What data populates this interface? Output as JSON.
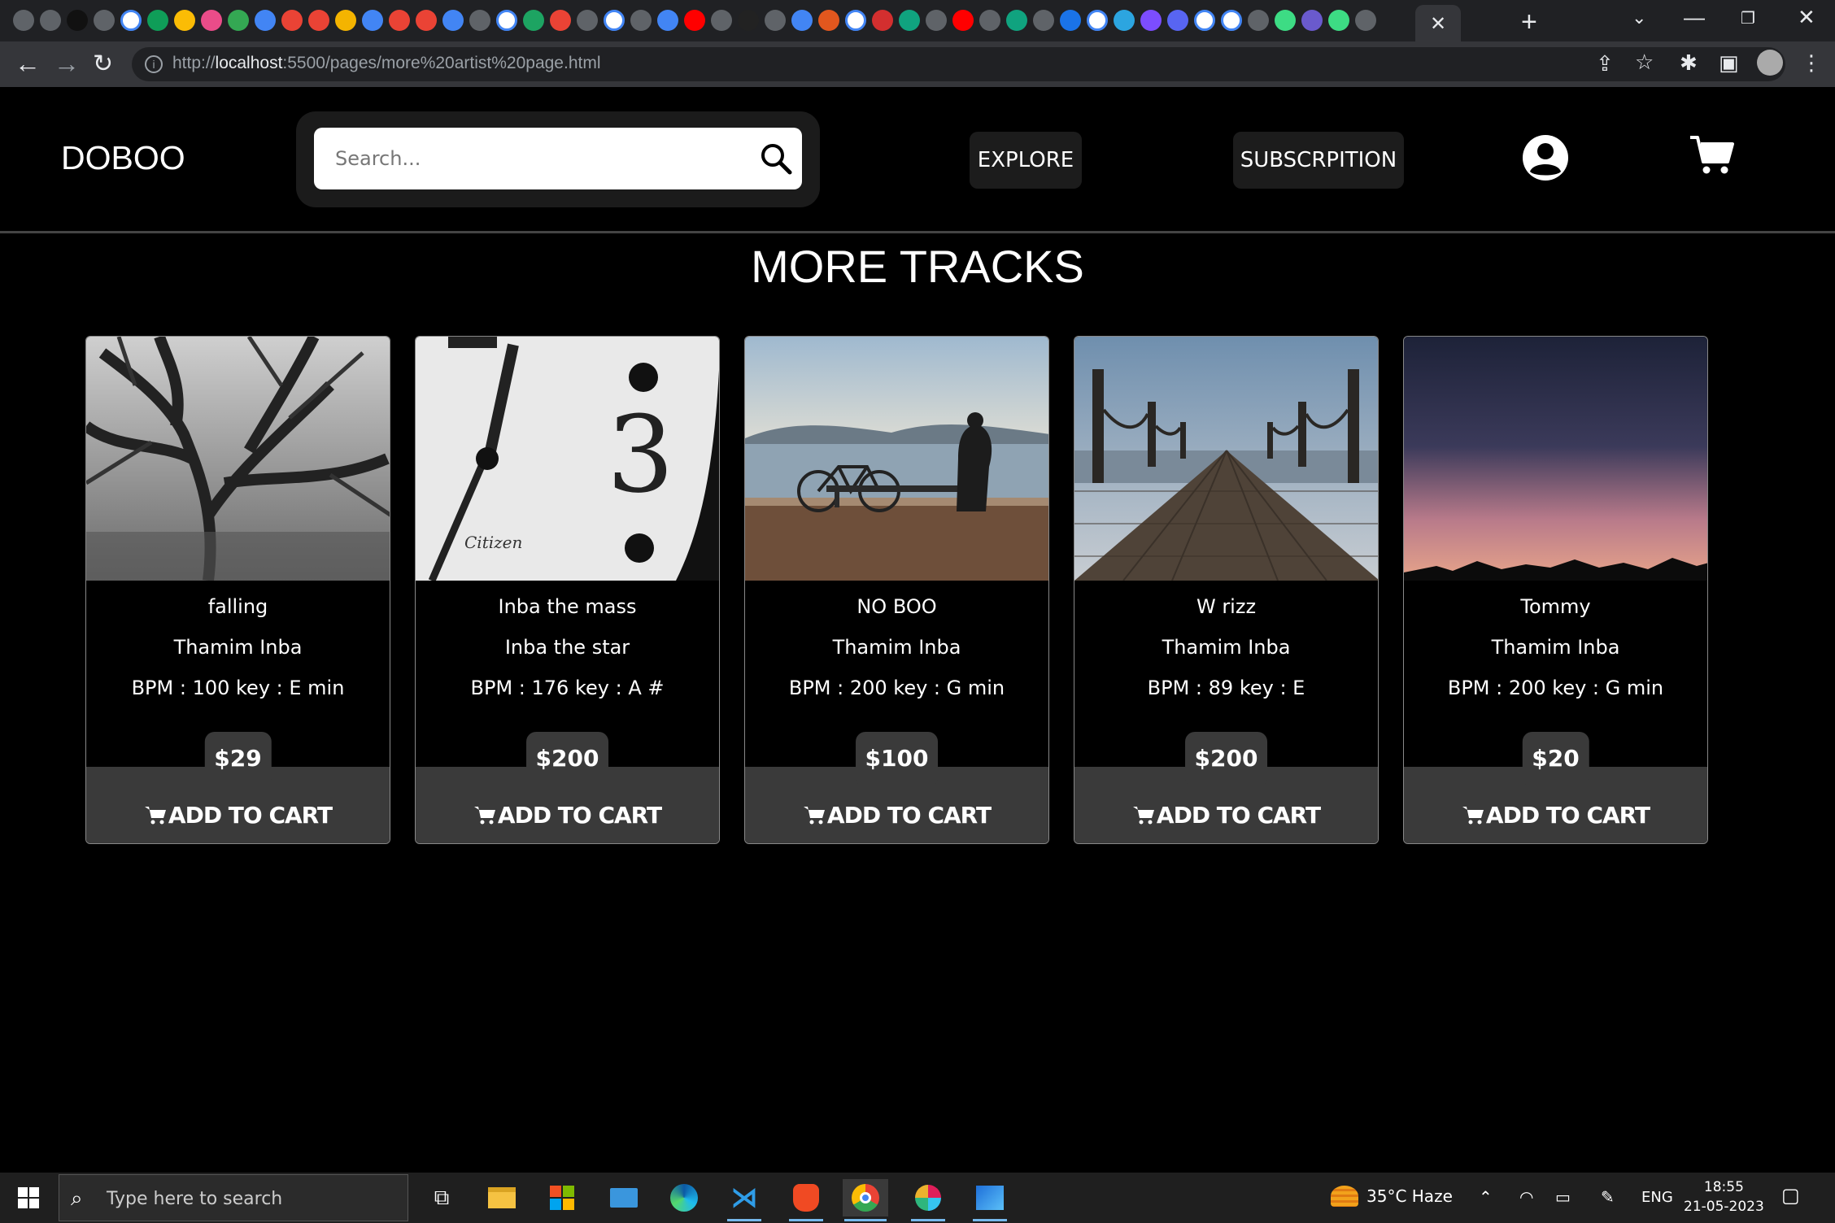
{
  "browser": {
    "url_prefix": "http://",
    "url_host": "localhost",
    "url_rest": ":5500/pages/more%20artist%20page.html",
    "close_tab": "✕",
    "new_tab": "+"
  },
  "header": {
    "logo": "DOBOO",
    "search_placeholder": "Search...",
    "nav": {
      "explore": "EXPLORE",
      "subscription": "SUBSCRPITION"
    }
  },
  "page_title": "MORE TRACKS",
  "tracks": [
    {
      "title": "falling",
      "artist": "Thamim Inba",
      "meta": "BPM : 100 key : E min",
      "price": "$29",
      "cta": "ADD TO CART",
      "art": "tree-icon"
    },
    {
      "title": "Inba the mass",
      "artist": "Inba the star",
      "meta": "BPM : 176 key : A #",
      "price": "$200",
      "cta": "ADD TO CART",
      "art": "clock-icon"
    },
    {
      "title": "NO BOO",
      "artist": "Thamim Inba",
      "meta": "BPM : 200 key : G min",
      "price": "$100",
      "cta": "ADD TO CART",
      "art": "bicycle-lake-icon"
    },
    {
      "title": "W rizz",
      "artist": "Thamim Inba",
      "meta": "BPM : 89 key : E",
      "price": "$200",
      "cta": "ADD TO CART",
      "art": "pier-icon"
    },
    {
      "title": "Tommy",
      "artist": "Thamim Inba",
      "meta": "BPM : 200 key : G min",
      "price": "$20",
      "cta": "ADD TO CART",
      "art": "sunset-icon"
    }
  ],
  "taskbar": {
    "search_placeholder": "Type here to search",
    "weather": "35°C  Haze",
    "language": "ENG",
    "time": "18:55",
    "date": "21-05-2023"
  },
  "colors": {
    "accent_blue": "#76b9ed",
    "card_bar": "#3a3a3a"
  }
}
